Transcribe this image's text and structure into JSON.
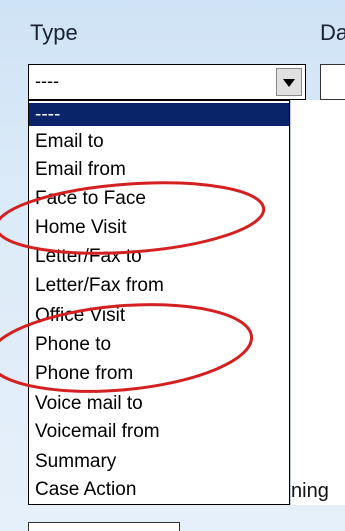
{
  "form": {
    "type_label": "Type",
    "date_label_partial": "Da",
    "select_value": "----",
    "right_panel_text_partial": "ning"
  },
  "dropdown": {
    "options": [
      "----",
      "Email to",
      "Email from",
      "Face to Face",
      "Home Visit",
      "Letter/Fax to",
      "Letter/Fax from",
      "Office Visit",
      "Phone to",
      "Phone from",
      "Voice mail to",
      "Voicemail from",
      "Summary",
      "Case Action"
    ],
    "selected_index": 0
  },
  "colors": {
    "selection_bg": "#0a246a",
    "annotation_red": "#d42020"
  },
  "icons": {
    "dropdown_arrow": "chevron-down-icon"
  }
}
